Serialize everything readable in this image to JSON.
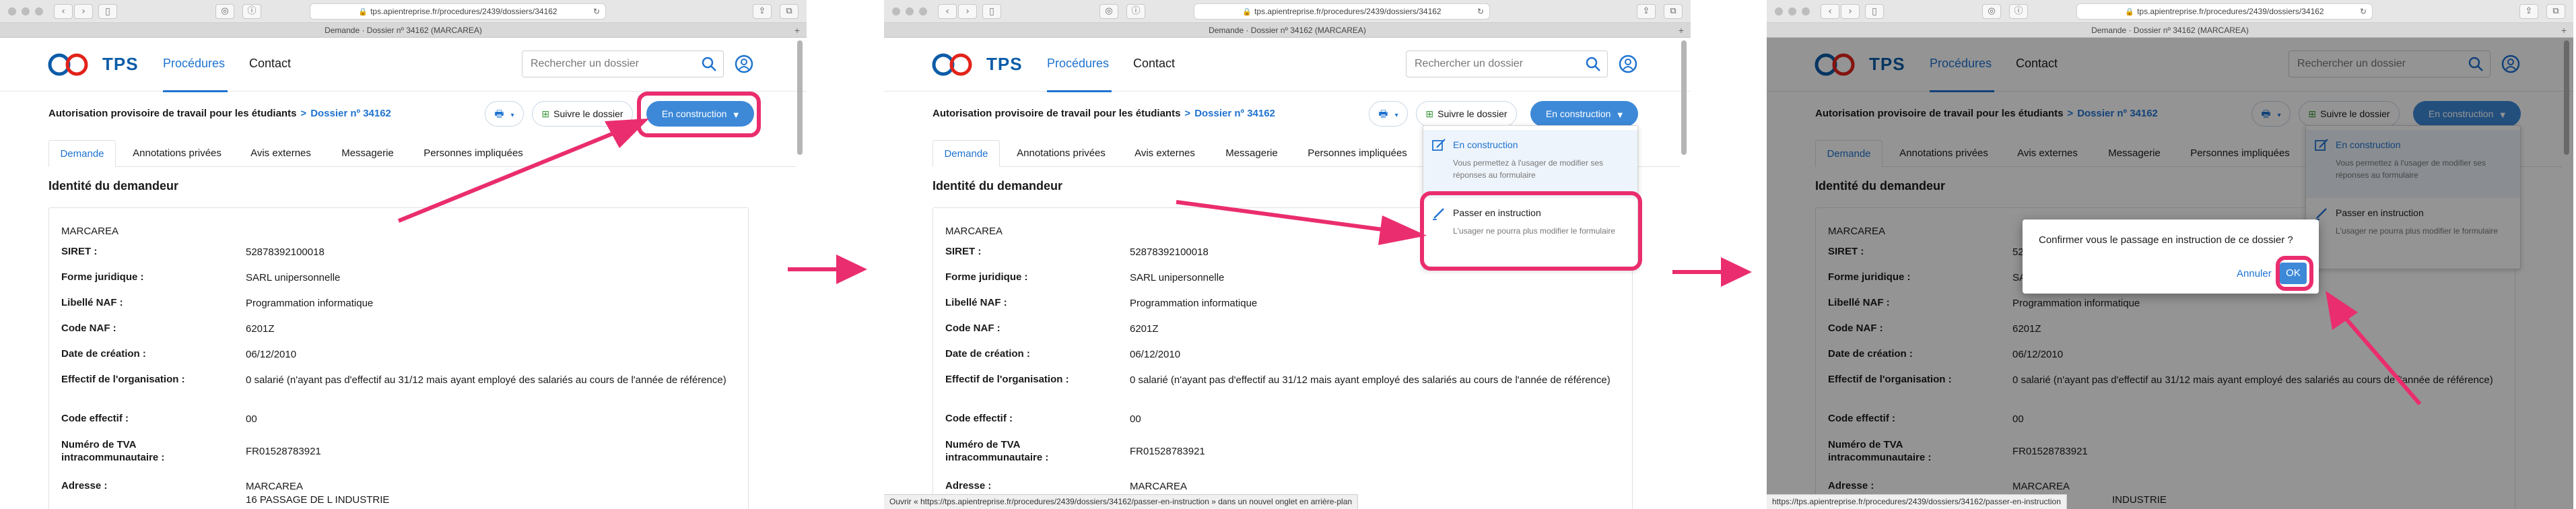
{
  "accent": "#1f73d0",
  "highlight_color": "#ea2d6e",
  "browser": {
    "url": "tps.apientreprise.fr/procedures/2439/dossiers/34162",
    "tab_title": "Demande · Dossier nº 34162 (MARCAREA)"
  },
  "header": {
    "logo_text": "TPS",
    "nav_procedures": "Procédures",
    "nav_contact": "Contact",
    "search_placeholder": "Rechercher un dossier"
  },
  "breadcrumb": {
    "procedure": "Autorisation provisoire de travail pour les étudiants",
    "separator": ">",
    "dossier": "Dossier nº 34162"
  },
  "actions": {
    "print_caret": "▾",
    "follow_label": "Suivre le dossier",
    "state_label": "En construction"
  },
  "tabs": [
    "Demande",
    "Annotations privées",
    "Avis externes",
    "Messagerie",
    "Personnes impliquées"
  ],
  "content": {
    "section_title": "Identité du demandeur",
    "company": "MARCAREA",
    "rows": [
      {
        "label": "SIRET :",
        "value": "52878392100018"
      },
      {
        "label": "Forme juridique :",
        "value": "SARL unipersonnelle"
      },
      {
        "label": "Libellé NAF :",
        "value": "Programmation informatique"
      },
      {
        "label": "Code NAF :",
        "value": "6201Z"
      },
      {
        "label": "Date de création :",
        "value": "06/12/2010"
      },
      {
        "label": "Effectif de l'organisation :",
        "value": "0 salarié (n'ayant pas d'effectif au 31/12 mais ayant employé des salariés au cours de l'année de référence)"
      },
      {
        "label": "Code effectif :",
        "value": "00"
      },
      {
        "label": "Numéro de TVA intracommunautaire :",
        "value": "FR01528783921"
      },
      {
        "label": "Adresse :",
        "value": "MARCAREA"
      }
    ],
    "address_line2": "16 PASSAGE DE L INDUSTRIE",
    "address_line2_partial": "INDUSTRIE"
  },
  "dropdown": {
    "item1_title": "En construction",
    "item1_desc": "Vous permettez à l'usager de modifier ses réponses au formulaire",
    "item2_title": "Passer en instruction",
    "item2_desc": "L'usager ne pourra plus modifier le formulaire"
  },
  "modal": {
    "text": "Confirmer vous le passage en instruction de ce dossier ?",
    "cancel": "Annuler",
    "ok": "OK"
  },
  "status_bar": {
    "panel2": "Ouvrir « https://tps.apientreprise.fr/procedures/2439/dossiers/34162/passer-en-instruction » dans un nouvel onglet en arrière-plan",
    "panel3": "https://tps.apientreprise.fr/procedures/2439/dossiers/34162/passer-en-instruction"
  }
}
